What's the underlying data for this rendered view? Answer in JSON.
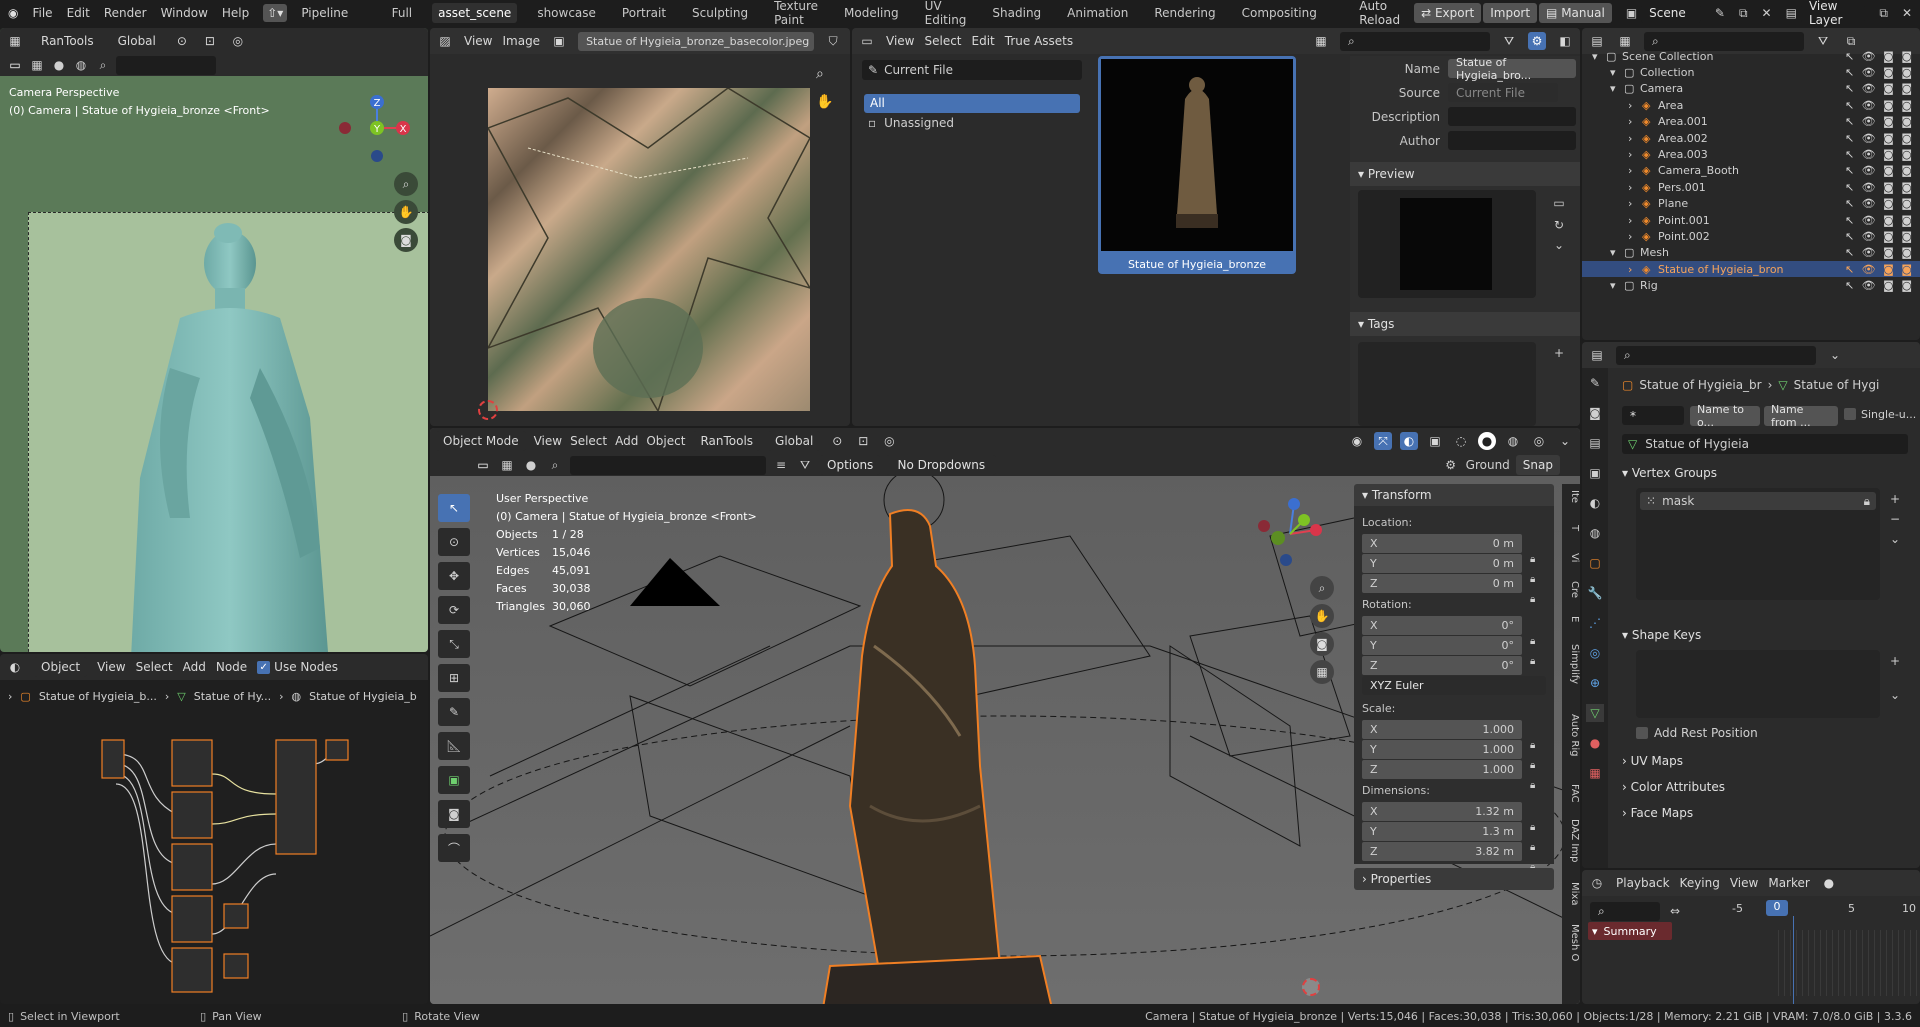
{
  "topbar": {
    "menus": [
      "File",
      "Edit",
      "Render",
      "Window",
      "Help"
    ],
    "pipeline": "Pipeline",
    "workspaces": [
      "Full",
      "asset_scene",
      "showcase",
      "Portrait",
      "Sculpting",
      "Texture Paint",
      "Modeling",
      "UV Editing",
      "Shading",
      "Animation",
      "Rendering",
      "Compositing"
    ],
    "active_workspace": "asset_scene",
    "auto_reload": "Auto Reload",
    "export": "Export",
    "import": "Import",
    "manual": "Manual",
    "scene": "Scene",
    "view_layer": "View Layer"
  },
  "camera_view": {
    "toolbar": {
      "rantools": "RanTools",
      "orientation": "Global"
    },
    "title": "Camera Perspective",
    "subtitle": "(0) Camera | Statue of Hygieia_bronze <Front>",
    "axis_labels": {
      "z": "Z",
      "y": "Y",
      "x": "X"
    }
  },
  "image_editor": {
    "view": "View",
    "image": "Image",
    "filename": "Statue of Hygieia_bronze_basecolor.jpeg"
  },
  "asset_browser": {
    "menus": [
      "View",
      "Select",
      "Edit",
      "True Assets"
    ],
    "library": "Current File",
    "catalogs": [
      "All",
      "Unassigned"
    ],
    "asset_name": "Statue of Hygieia_bronze",
    "props": {
      "name_label": "Name",
      "name_value": "Statue of Hygieia_bro...",
      "source_label": "Source",
      "source_value": "Current File",
      "description_label": "Description",
      "author_label": "Author"
    },
    "preview_label": "Preview",
    "tags_label": "Tags"
  },
  "outliner": {
    "rows": [
      {
        "label": "Scene Collection",
        "indent": 0
      },
      {
        "label": "Collection",
        "indent": 1
      },
      {
        "label": "Camera",
        "indent": 1
      },
      {
        "label": "Area",
        "indent": 2
      },
      {
        "label": "Area.001",
        "indent": 2
      },
      {
        "label": "Area.002",
        "indent": 2
      },
      {
        "label": "Area.003",
        "indent": 2
      },
      {
        "label": "Camera_Booth",
        "indent": 2
      },
      {
        "label": "Pers.001",
        "indent": 2
      },
      {
        "label": "Plane",
        "indent": 2
      },
      {
        "label": "Point.001",
        "indent": 2
      },
      {
        "label": "Point.002",
        "indent": 2
      },
      {
        "label": "Mesh",
        "indent": 1
      },
      {
        "label": "Statue of Hygieia_bron",
        "indent": 2,
        "selected": true
      },
      {
        "label": "Rig",
        "indent": 1
      }
    ]
  },
  "properties": {
    "breadcrumb": [
      "Statue of Hygieia_br",
      "Statue of Hygi"
    ],
    "search_value": "*",
    "name_to_o": "Name to o...",
    "name_from": "Name from ...",
    "single": "Single-u...",
    "mesh_name": "Statue of Hygieia",
    "vertex_groups": "Vertex Groups",
    "vg_item": "mask",
    "shape_keys": "Shape Keys",
    "add_rest": "Add Rest Position",
    "uv_maps": "UV Maps",
    "color_attr": "Color Attributes",
    "face_maps": "Face Maps"
  },
  "node_editor": {
    "mode": "Object",
    "menus": [
      "View",
      "Select",
      "Add",
      "Node"
    ],
    "use_nodes": "Use Nodes",
    "breadcrumb": [
      "Statue of Hygieia_b...",
      "Statue of Hy...",
      "Statue of Hygieia_b"
    ]
  },
  "viewport": {
    "mode": "Object Mode",
    "menus": [
      "View",
      "Select",
      "Add",
      "Object"
    ],
    "rantools": "RanTools",
    "orientation": "Global",
    "options": "Options",
    "dropdowns": "No Dropdowns",
    "ground": "Ground",
    "snap": "Snap",
    "title": "User Perspective",
    "subtitle": "(0) Camera | Statue of Hygieia_bronze <Front>",
    "stats": [
      {
        "k": "Objects",
        "v": "1 / 28"
      },
      {
        "k": "Vertices",
        "v": "15,046"
      },
      {
        "k": "Edges",
        "v": "45,091"
      },
      {
        "k": "Faces",
        "v": "30,038"
      },
      {
        "k": "Triangles",
        "v": "30,060"
      }
    ],
    "transform": {
      "title": "Transform",
      "location": "Location:",
      "loc": [
        {
          "a": "X",
          "v": "0 m"
        },
        {
          "a": "Y",
          "v": "0 m"
        },
        {
          "a": "Z",
          "v": "0 m"
        }
      ],
      "rotation": "Rotation:",
      "rot": [
        {
          "a": "X",
          "v": "0°"
        },
        {
          "a": "Y",
          "v": "0°"
        },
        {
          "a": "Z",
          "v": "0°"
        }
      ],
      "euler": "XYZ Euler",
      "scale": "Scale:",
      "scl": [
        {
          "a": "X",
          "v": "1.000"
        },
        {
          "a": "Y",
          "v": "1.000"
        },
        {
          "a": "Z",
          "v": "1.000"
        }
      ],
      "dimensions": "Dimensions:",
      "dim": [
        {
          "a": "X",
          "v": "1.32 m"
        },
        {
          "a": "Y",
          "v": "1.3 m"
        },
        {
          "a": "Z",
          "v": "3.82 m"
        }
      ],
      "properties": "Properties"
    },
    "side_tabs": [
      "Ite",
      "T",
      "Vi",
      "Cre",
      "E",
      "Simplify",
      "Auto Rig",
      "FAC",
      "DAZ Imp",
      "Mixa",
      "Mesh O"
    ]
  },
  "timeline": {
    "menus": [
      "Playback",
      "Keying",
      "View",
      "Marker"
    ],
    "ticks": [
      "-5",
      "0",
      "5",
      "10"
    ],
    "current": "0",
    "summary": "Summary"
  },
  "status": {
    "left1": "Select in Viewport",
    "left2": "Pan View",
    "left3": "Rotate View",
    "right": "Camera | Statue of Hygieia_bronze | Verts:15,046 | Faces:30,038 | Tris:30,060 | Objects:1/28 | Memory: 2.21 GiB | VRAM: 7.0/8.0 GiB | 3.3.6"
  },
  "colors": {
    "accent": "#4772b3",
    "selection": "#f07f24",
    "header": "#303030",
    "bg": "#1d1d1d"
  }
}
